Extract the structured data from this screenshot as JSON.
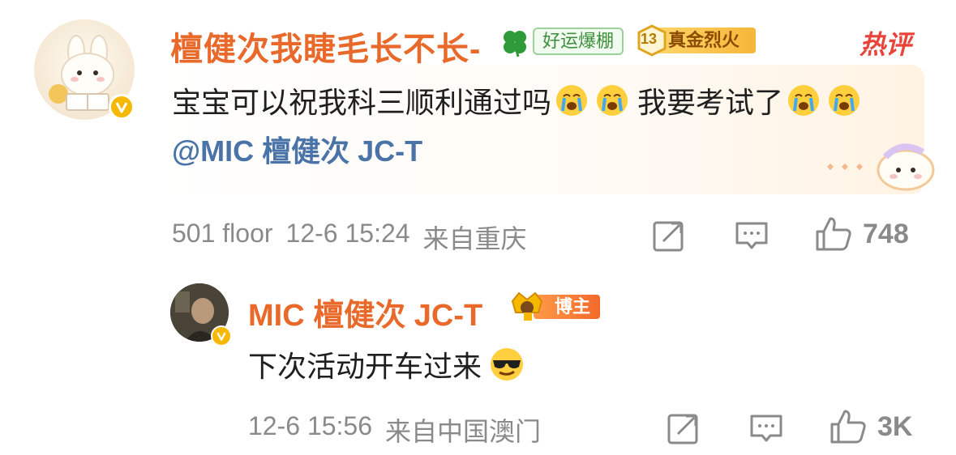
{
  "comment": {
    "username": "檀健次我睫毛长不长-",
    "badge_lucky": "好运爆棚",
    "badge_gold_level": "13",
    "badge_gold_label": "真金烈火",
    "hot_label": "热评",
    "text_part1": "宝宝可以祝我科三顺利通过吗",
    "text_part2": "我要考试了",
    "mention": "@MIC 檀健次 JC-T",
    "floor": "501 floor",
    "timestamp": "12-6 15:24",
    "location": "来自重庆",
    "like_count": "748",
    "icons": [
      "share-icon",
      "comment-icon",
      "like-icon",
      "crying-emoji-icon",
      "clover-icon",
      "verified-icon"
    ]
  },
  "reply": {
    "username": "MIC 檀健次 JC-T",
    "badge_blogger": "博主",
    "text": "下次活动开车过来",
    "timestamp": "12-6 15:56",
    "location": "来自中国澳门",
    "like_count": "3K",
    "icons": [
      "cool-emoji-icon",
      "crown-icon"
    ]
  },
  "colors": {
    "username": "#e8692a",
    "mention": "#4a73a8",
    "meta": "#8a8a8a",
    "hot": "#e8443a",
    "verify": "#f6b800"
  }
}
